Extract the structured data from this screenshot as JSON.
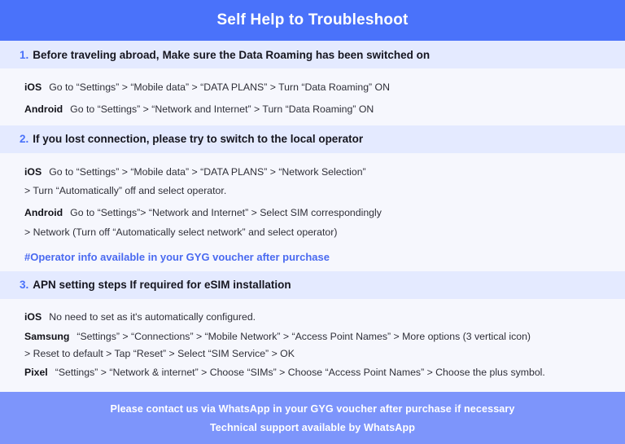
{
  "header": {
    "title": "Self Help to Troubleshoot"
  },
  "sections": [
    {
      "number": "1.",
      "heading_strong": "Before traveling abroad,",
      "heading_rest": "Make sure the Data Roaming has been switched on",
      "rows": [
        {
          "platform": "iOS",
          "text": "Go to “Settings” > “Mobile data” > “DATA PLANS” > Turn “Data Roaming” ON"
        },
        {
          "platform": "Android",
          "text": "Go to “Settings” > “Network and Internet” > Turn “Data Roaming” ON"
        }
      ]
    },
    {
      "number": "2.",
      "heading_strong": "If you lost connection, please try to switch to the local operator",
      "heading_rest": "",
      "rows": [
        {
          "platform": "iOS",
          "text": "Go to “Settings” > “Mobile data” > “DATA PLANS” > “Network Selection”"
        },
        {
          "platform": "",
          "text": "> Turn “Automatically” off and select operator."
        },
        {
          "platform": "Android",
          "text": "Go to “Settings”>  “Network and Internet” > Select SIM correspondingly"
        },
        {
          "platform": "",
          "text": "> Network (Turn off “Automatically select network” and select operator)"
        }
      ],
      "note": "#Operator info available in your GYG voucher after purchase"
    },
    {
      "number": "3.",
      "heading_strong": "APN setting steps If required for eSIM installation",
      "heading_rest": "",
      "rows": [
        {
          "platform": "iOS",
          "text": "No need to set as it's automatically configured."
        },
        {
          "platform": "Samsung",
          "text": "“Settings” > “Connections” > “Mobile Network” > “Access Point Names” > More options (3 vertical icon)"
        },
        {
          "platform": "",
          "text": "> Reset to default > Tap “Reset” > Select “SIM Service” > OK"
        },
        {
          "platform": "Pixel",
          "text": "“Settings” > “Network & internet” > Choose “SIMs” > Choose “Access Point Names” > Choose the plus symbol."
        }
      ]
    }
  ],
  "footer": {
    "line1": "Please contact us via WhatsApp  in your GYG voucher after purchase if necessary",
    "line2": "Technical support available by WhatsApp"
  },
  "colors": {
    "header_blue": "#4a72fa",
    "footer_blue": "#7d95fb",
    "band_blue": "#e4eaff",
    "body_bg": "#f6f7fd",
    "accent_text": "#4a6af0"
  }
}
